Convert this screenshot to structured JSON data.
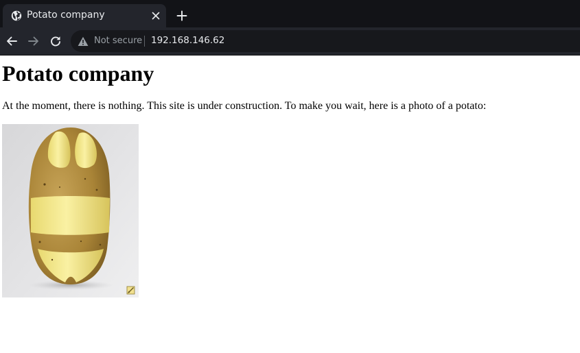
{
  "browser": {
    "tab": {
      "title": "Potato company",
      "favicon": "globe-icon",
      "close_icon": "close-icon"
    },
    "new_tab_icon": "plus-icon",
    "toolbar": {
      "back_icon": "arrow-left-icon",
      "forward_icon": "arrow-right-icon",
      "reload_icon": "reload-icon"
    },
    "omnibox": {
      "security_icon": "warning-triangle-icon",
      "security_label": "Not secure",
      "url": "192.168.146.62"
    },
    "colors": {
      "tabstrip_bg": "#121317",
      "toolbar_bg": "#23252c",
      "omnibox_bg": "#17181c",
      "text_light": "#e8eaed",
      "text_muted": "#9aa0a6"
    }
  },
  "page": {
    "heading": "Potato company",
    "paragraph": "At the moment, there is nothing. This site is under construction. To make you wait, here is a photo of a potato:",
    "image": {
      "subject": "potato-photo",
      "edit_icon": "pencil-icon"
    }
  }
}
